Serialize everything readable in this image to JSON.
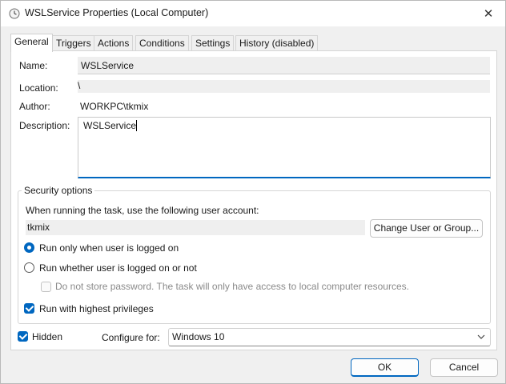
{
  "window": {
    "title": "WSLService Properties (Local Computer)",
    "close_glyph": "✕",
    "icon": "clock-icon"
  },
  "tabs": [
    {
      "label": "General",
      "active": true
    },
    {
      "label": "Triggers",
      "active": false
    },
    {
      "label": "Actions",
      "active": false
    },
    {
      "label": "Conditions",
      "active": false
    },
    {
      "label": "Settings",
      "active": false
    },
    {
      "label": "History (disabled)",
      "active": false
    }
  ],
  "general": {
    "name_label": "Name:",
    "name_value": "WSLService",
    "location_label": "Location:",
    "location_value": "\\",
    "author_label": "Author:",
    "author_value": "WORKPC\\tkmix",
    "description_label": "Description:",
    "description_value": "WSLService"
  },
  "security": {
    "group_label": "Security options",
    "account_prompt": "When running the task, use the following user account:",
    "account_value": "tkmix",
    "change_button": "Change User or Group...",
    "radio_logged_on": "Run only when user is logged on",
    "radio_logged_on_selected": true,
    "radio_whether": "Run whether user is logged on or not",
    "radio_whether_selected": false,
    "no_store_password": "Do not store password.  The task will only have access to local computer resources.",
    "no_store_password_checked": false,
    "highest_privileges": "Run with highest privileges",
    "highest_privileges_checked": true
  },
  "footer": {
    "hidden_label": "Hidden",
    "hidden_checked": true,
    "configure_label": "Configure for:",
    "configure_value": "Windows 10"
  },
  "buttons": {
    "ok": "OK",
    "cancel": "Cancel"
  },
  "colors": {
    "accent": "#0067c0",
    "panel": "#ffffff",
    "background": "#f0f0f0"
  }
}
